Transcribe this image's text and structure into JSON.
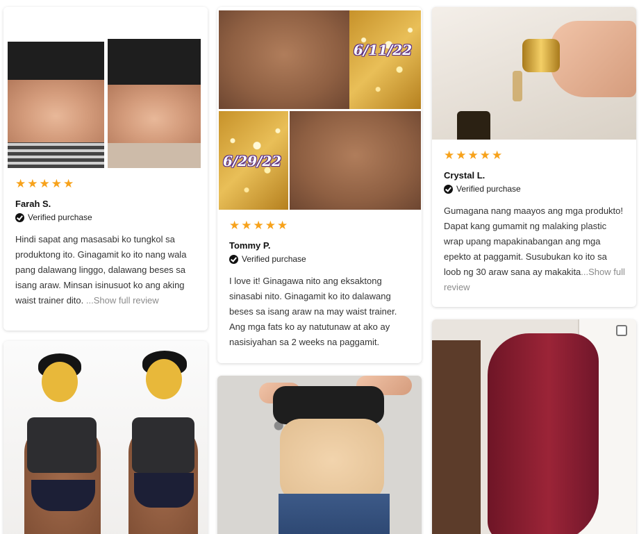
{
  "reviews": [
    {
      "name": "Farah S.",
      "stars": "★★★★★",
      "verified": "Verified purchase",
      "text": "Hindi sapat ang masasabi ko tungkol sa produktong ito. Ginagamit ko ito nang wala pang dalawang linggo, dalawang beses sa isang araw. Minsan isinusuot ko ang aking waist trainer dito. ",
      "more": "...Show full review"
    },
    {
      "name": "Tommy P.",
      "stars": "★★★★★",
      "verified": "Verified purchase",
      "text": "I love it! Ginagawa nito ang eksaktong sinasabi nito. Ginagamit ko ito dalawang beses sa isang araw na may waist trainer. Ang mga fats ko ay natutunaw at ako ay nasisiyahan sa 2 weeks na paggamit.",
      "dates": [
        "6/11/22",
        "6/29/22"
      ]
    },
    {
      "name": "Crystal L.",
      "stars": "★★★★★",
      "verified": "Verified purchase",
      "text": "Gumagana nang maayos ang mga produkto! Dapat kang gumamit ng malaking plastic wrap upang mapakinabangan ang mga epekto at paggamit. Susubukan ko ito sa loob ng 30 araw sana ay makakita",
      "more": "...Show full review"
    }
  ],
  "colors": {
    "star": "#f7a21b",
    "more_link": "#8b8b8b"
  },
  "icons": {
    "verified": "check-circle-icon",
    "star": "star-icon"
  }
}
